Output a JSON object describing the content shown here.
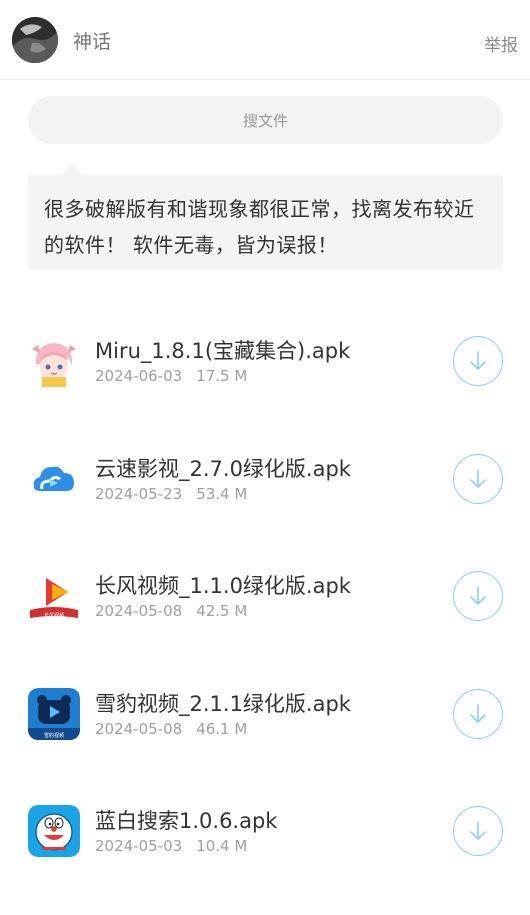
{
  "header": {
    "username": "神话",
    "report_label": "举报",
    "avatar_icon": "user-avatar"
  },
  "search": {
    "label": "搜文件"
  },
  "notice": {
    "text": "很多破解版有和谐现象都很正常，找离发布较近的软件！ 软件无毒，皆为误报！"
  },
  "files": [
    {
      "name": "Miru_1.8.1(宝藏集合).apk",
      "date": "2024-06-03",
      "size": "17.5 M",
      "icon": "miru-app-icon"
    },
    {
      "name": "云速影视_2.7.0绿化版.apk",
      "date": "2024-05-23",
      "size": "53.4 M",
      "icon": "cloud-app-icon"
    },
    {
      "name": "长风视频_1.1.0绿化版.apk",
      "date": "2024-05-08",
      "size": "42.5 M",
      "icon": "play-app-icon",
      "icon_text": "长风视频"
    },
    {
      "name": "雪豹视频_2.1.1绿化版.apk",
      "date": "2024-05-08",
      "size": "46.1 M",
      "icon": "leopard-app-icon",
      "icon_text": "雪豹视频"
    },
    {
      "name": "蓝白搜索1.0.6.apk",
      "date": "2024-05-03",
      "size": "10.4 M",
      "icon": "doraemon-app-icon"
    }
  ],
  "colors": {
    "download_accent": "#8fd0ea",
    "meta_text": "#a0a0a0"
  }
}
